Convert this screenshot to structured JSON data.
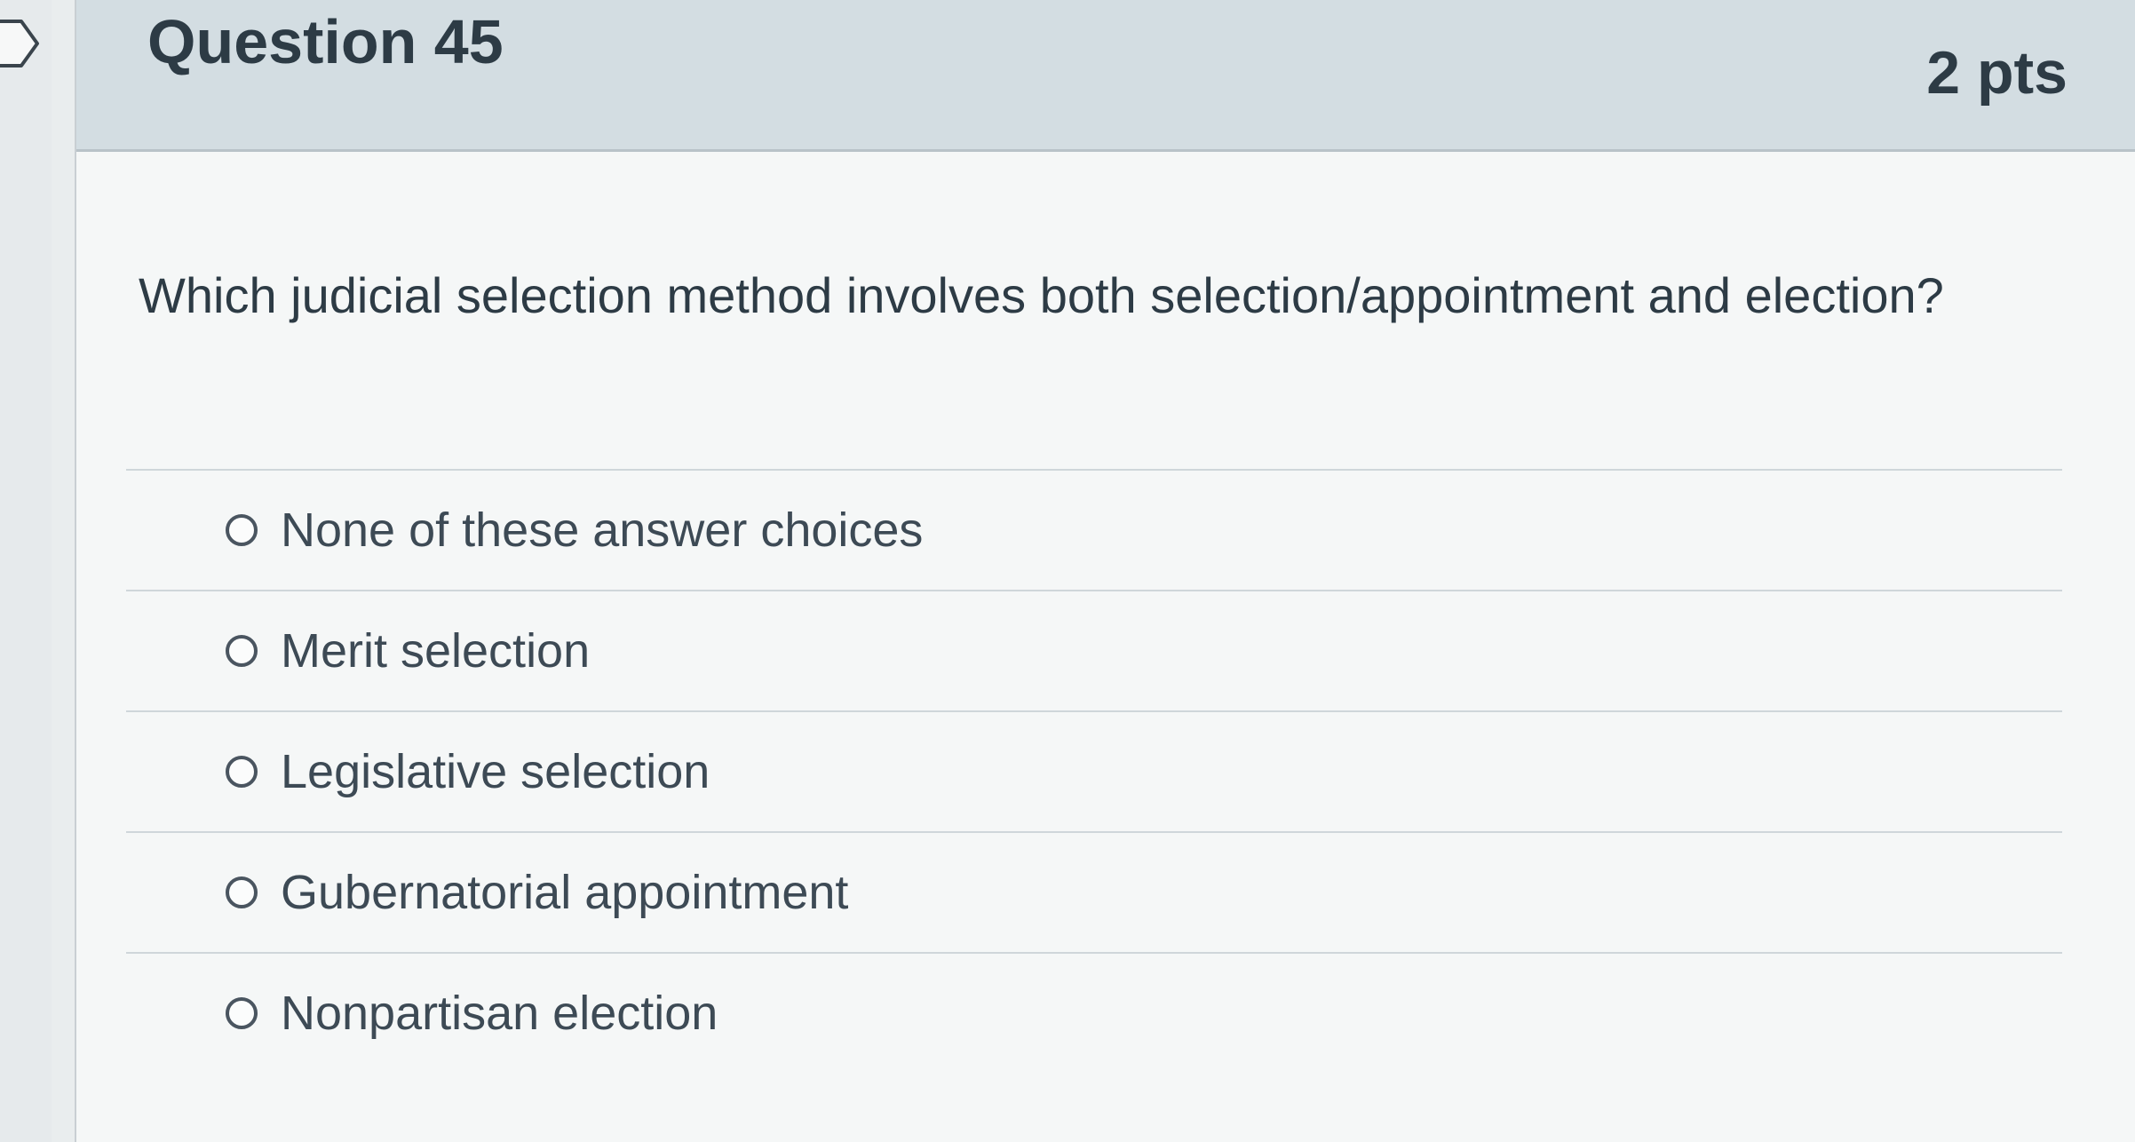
{
  "header": {
    "question_title": "Question 45",
    "points": "2 pts"
  },
  "question": {
    "text": "Which judicial selection method involves both selection/appointment and election?"
  },
  "answers": [
    {
      "label": "None of these answer choices",
      "selected": false
    },
    {
      "label": "Merit selection",
      "selected": false
    },
    {
      "label": "Legislative selection",
      "selected": false
    },
    {
      "label": "Gubernatorial appointment",
      "selected": false
    },
    {
      "label": "Nonpartisan election",
      "selected": false
    }
  ],
  "icons": {
    "flag": "flag-icon",
    "radio": "radio-icon"
  },
  "colors": {
    "header_bg": "#d3dde2",
    "card_bg": "#f5f7f7",
    "text": "#2d3b45"
  }
}
